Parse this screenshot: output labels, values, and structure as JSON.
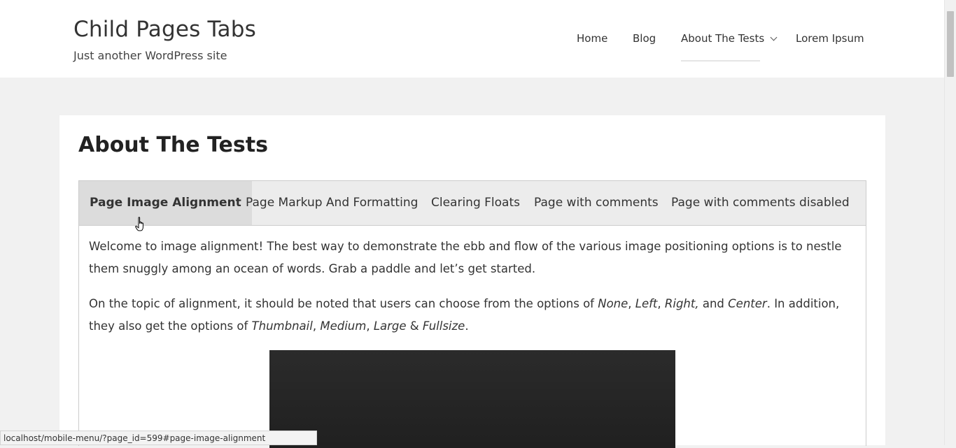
{
  "site": {
    "title": "Child Pages Tabs",
    "tagline": "Just another WordPress site"
  },
  "nav": {
    "items": [
      {
        "label": "Home"
      },
      {
        "label": "Blog"
      },
      {
        "label": "About The Tests",
        "active": true,
        "has_submenu": true
      },
      {
        "label": "Lorem Ipsum"
      }
    ]
  },
  "page": {
    "title": "About The Tests",
    "tabs": [
      {
        "label": "Page Image Alignment",
        "active": true
      },
      {
        "label": "Page Markup And Formatting"
      },
      {
        "label": "Clearing Floats"
      },
      {
        "label": "Page with comments"
      },
      {
        "label": "Page with comments disabled"
      }
    ],
    "paragraph1": "Welcome to image alignment! The best way to demonstrate the ebb and flow of the various image positioning options is to nestle them snuggly among an ocean of words. Grab a paddle and let’s get started.",
    "paragraph2": {
      "t1": "On the topic of alignment, it should be noted that users can choose from the options of ",
      "e1": "None",
      "t2": ", ",
      "e2": "Left",
      "t3": ", ",
      "e3": "Right,",
      "t4": " and ",
      "e4": "Center",
      "t5": ". In addition, they also get the options of ",
      "e5": "Thumbnail",
      "t6": ", ",
      "e6": "Medium",
      "t7": ", ",
      "e7": "Large",
      "t8": " & ",
      "e8": "Fullsize",
      "t9": "."
    }
  },
  "status_bar": {
    "url": "localhost/mobile-menu/?page_id=599#page-image-alignment"
  }
}
